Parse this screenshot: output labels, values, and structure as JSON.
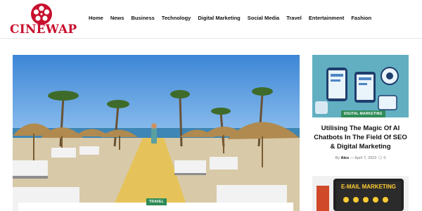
{
  "site": {
    "name": "CINEWAP",
    "brand_color": "#c8102e"
  },
  "nav": {
    "items": [
      "Home",
      "News",
      "Business",
      "Technology",
      "Digital Marketing",
      "Social Media",
      "Travel",
      "Entertainment",
      "Fashion"
    ]
  },
  "hero": {
    "category": "TRAVEL",
    "category_color": "#2e8b57"
  },
  "sidebar": {
    "post1": {
      "category": "DIGITAL MARKETING",
      "title": "Utilising The Magic Of AI Chatbots In The Field Of SEO & Digital Marketing",
      "by": "By",
      "author": "Alex",
      "separator": "—",
      "date": "April 7, 2023",
      "comments": "0"
    },
    "post2": {
      "image_text": "E-MAIL MARKETING"
    }
  }
}
